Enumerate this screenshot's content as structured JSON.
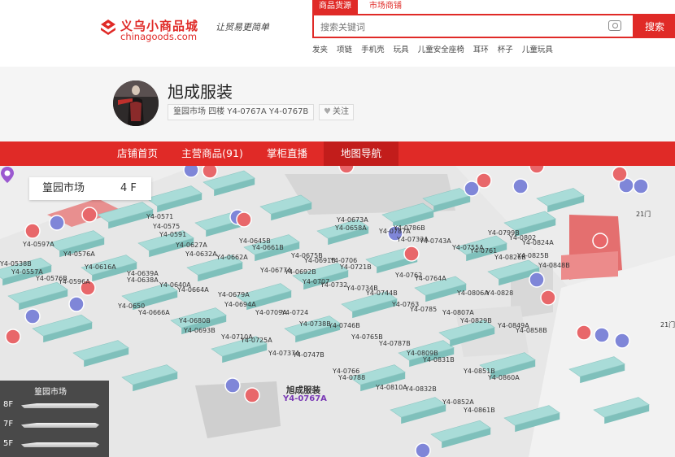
{
  "logo": {
    "name_cn": "义乌小商品城",
    "domain": "chinagoods.com",
    "slogan": "让贸易更简单"
  },
  "search": {
    "tabs": [
      "商品货源",
      "市场商铺"
    ],
    "active_tab": 0,
    "placeholder": "搜索关键词",
    "button_label": "搜索",
    "hotwords": [
      "发夹",
      "项链",
      "手机壳",
      "玩具",
      "儿童安全座椅",
      "耳环",
      "杯子",
      "儿童玩具"
    ]
  },
  "shop": {
    "name": "旭成服装",
    "address": "篁园市场 四楼 Y4-0767A Y4-0767B",
    "follow_label": "关注"
  },
  "nav": {
    "items": [
      "店铺首页",
      "主营商品(91)",
      "掌柜直播",
      "地图导航"
    ],
    "active": 3
  },
  "map": {
    "market": "篁园市场",
    "floor": "4 F",
    "floor_panel_title": "篁园市场",
    "floors": [
      "8F",
      "7F",
      "5F"
    ],
    "target_name": "旭成服装",
    "target_code": "Y4-0767A",
    "edge_labels": [
      "21门",
      "21门"
    ],
    "stall_labels": [
      "Y4-0571",
      "Y4-0575",
      "Y4-0591",
      "Y4-0597A",
      "Y4-0576A",
      "Y4-0538B",
      "Y4-0557A",
      "Y4-0576B",
      "Y4-0596A",
      "Y4-0616A",
      "Y4-0639A",
      "Y4-0638A",
      "Y4-0640A",
      "Y4-0664A",
      "Y4-0627A",
      "Y4-0632A",
      "Y4-0650",
      "Y4-0666A",
      "Y4-0679A",
      "Y4-0694A",
      "Y4-0680B",
      "Y4-0693B",
      "Y4-0709A",
      "Y4-0724",
      "Y4-0710A",
      "Y4-0725A",
      "Y4-0737A",
      "Y4-0747B",
      "Y4-0738B",
      "Y4-0746B",
      "Y4-0765B",
      "Y4-0787B",
      "Y4-0766",
      "Y4-0788",
      "Y4-0810A",
      "Y4-0832B",
      "Y4-0809B",
      "Y4-0831B",
      "Y4-0807A",
      "Y4-0829B",
      "Y4-0852A",
      "Y4-0861B",
      "Y4-0851B",
      "Y4-0860A",
      "Y4-0849A",
      "Y4-0858B",
      "Y4-0806A",
      "Y4-0828",
      "Y4-0763",
      "Y4-0785",
      "Y4-0764A",
      "Y4-0762",
      "Y4-0707",
      "Y4-0732",
      "Y4-0734B",
      "Y4-0744B",
      "Y4-0706",
      "Y4-0721B",
      "Y4-0662A",
      "Y4-0677A",
      "Y4-0692B",
      "Y4-0675B",
      "Y4-0691B",
      "Y4-0661B",
      "Y4-0645B",
      "Y4-0673A",
      "Y4-0658A",
      "Y4-0733A",
      "Y4-0743A",
      "Y4-0755A",
      "Y4-0761",
      "Y4-0802",
      "Y4-0824A",
      "Y4-0848B",
      "Y4-0825B",
      "Y4-0826B",
      "Y4-0799B",
      "Y4-0787A",
      "Y4-0786B"
    ]
  }
}
